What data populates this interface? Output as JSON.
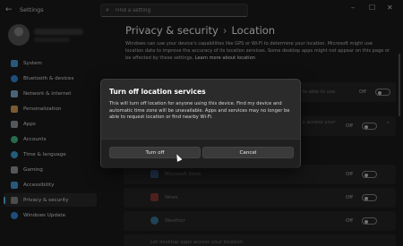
{
  "app": {
    "title": "Settings"
  },
  "search": {
    "placeholder": "Find a setting"
  },
  "sidebar": {
    "items": [
      {
        "label": "System",
        "icon": "monitor-icon",
        "color": "#4aa3df",
        "active": false
      },
      {
        "label": "Bluetooth & devices",
        "icon": "bluetooth-icon",
        "color": "#3a8ee6",
        "active": false
      },
      {
        "label": "Network & internet",
        "icon": "wifi-icon",
        "color": "#8ab4d8",
        "active": false
      },
      {
        "label": "Personalization",
        "icon": "brush-icon",
        "color": "#e0a35a",
        "active": false
      },
      {
        "label": "Apps",
        "icon": "apps-icon",
        "color": "#9aa0a6",
        "active": false
      },
      {
        "label": "Accounts",
        "icon": "person-icon",
        "color": "#4cc48a",
        "active": false
      },
      {
        "label": "Time & language",
        "icon": "globe-clock-icon",
        "color": "#3fa9e0",
        "active": false
      },
      {
        "label": "Gaming",
        "icon": "controller-icon",
        "color": "#9aa0a6",
        "active": false
      },
      {
        "label": "Accessibility",
        "icon": "accessibility-icon",
        "color": "#4aa3df",
        "active": false
      },
      {
        "label": "Privacy & security",
        "icon": "shield-icon",
        "color": "#8c8c8c",
        "active": true
      },
      {
        "label": "Windows Update",
        "icon": "update-icon",
        "color": "#3a8ee6",
        "active": false
      }
    ]
  },
  "header": {
    "breadcrumb_parent": "Privacy & security",
    "breadcrumb_sep": "›",
    "breadcrumb_current": "Location"
  },
  "main": {
    "description": "Windows can use your device's capabilities like GPS or Wi-Fi to determine your location. Microsoft might use location data to improve the accuracy of its location services. Some desktop apps might not appear on this page or be affected by these settings.",
    "learn_more": "Learn more about location",
    "rows": [
      {
        "text": "le able to use",
        "state": "Off"
      },
      {
        "text": "s access your",
        "state": "Off"
      },
      {
        "text": "Microsoft Store",
        "state": "Off"
      },
      {
        "text": "News",
        "state": "Off"
      },
      {
        "text": "Weather",
        "state": "Off"
      },
      {
        "text": "Let desktop apps access your location",
        "state": ""
      }
    ]
  },
  "dialog": {
    "title": "Turn off location services",
    "message": "This will turn off location for anyone using this device. Find my device and automatic time zone will be unavailable. Apps and services may no longer be able to request location or find nearby Wi-Fi.",
    "primary": "Turn off",
    "secondary": "Cancel"
  }
}
